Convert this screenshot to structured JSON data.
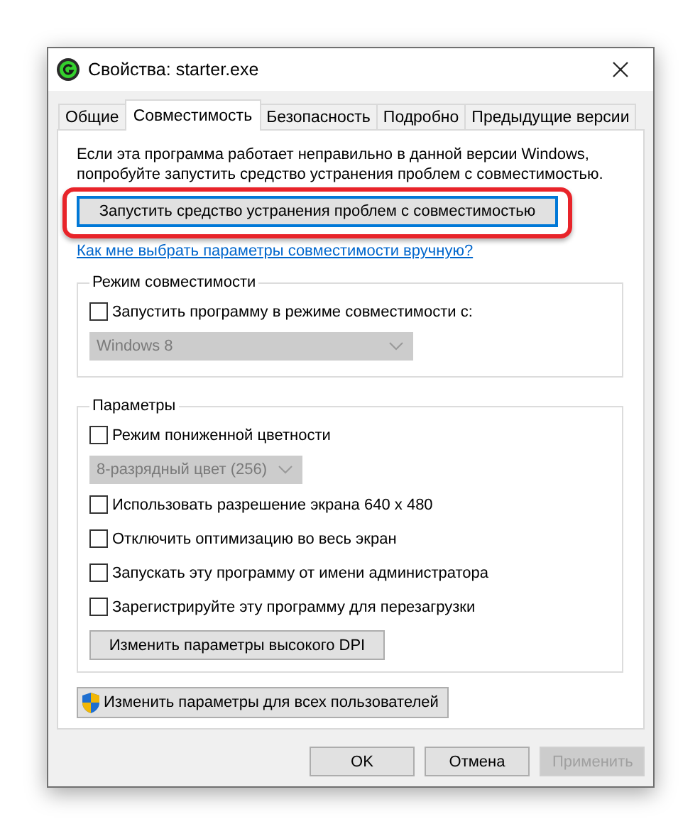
{
  "window": {
    "title": "Свойства: starter.exe"
  },
  "tabs": [
    {
      "label": "Общие",
      "selected": false
    },
    {
      "label": "Совместимость",
      "selected": true
    },
    {
      "label": "Безопасность",
      "selected": false
    },
    {
      "label": "Подробно",
      "selected": false
    },
    {
      "label": "Предыдущие версии",
      "selected": false
    }
  ],
  "intro": "Если эта программа работает неправильно в данной версии Windows, попробуйте запустить средство устранения проблем с совместимостью.",
  "troubleshoot_button": {
    "label": "Запустить средство устранения проблем с совместимостью",
    "highlighted": true
  },
  "manual_link": "Как мне выбрать параметры совместимости вручную?",
  "groups": [
    {
      "title": "Режим совместимости",
      "items": [
        {
          "kind": "checkbox",
          "label": "Запустить программу в режиме совместимости с:",
          "checked": false
        },
        {
          "kind": "combo",
          "value": "Windows 8",
          "disabled": true,
          "wide": true
        }
      ]
    },
    {
      "title": "Параметры",
      "items": [
        {
          "kind": "checkbox",
          "label": "Режим пониженной цветности",
          "checked": false
        },
        {
          "kind": "combo",
          "value": "8-разрядный цвет (256)",
          "disabled": true,
          "wide": false
        },
        {
          "kind": "checkbox",
          "label": "Использовать разрешение экрана 640 x 480",
          "checked": false
        },
        {
          "kind": "checkbox",
          "label": "Отключить оптимизацию во весь экран",
          "checked": false
        },
        {
          "kind": "checkbox",
          "label": "Запускать эту программу от имени администратора",
          "checked": false
        },
        {
          "kind": "checkbox",
          "label": "Зарегистрируйте эту программу для перезагрузки",
          "checked": false
        },
        {
          "kind": "button",
          "label": "Изменить параметры высокого DPI"
        }
      ]
    }
  ],
  "all_users_button": {
    "label": "Изменить параметры для всех пользователей"
  },
  "buttons": [
    {
      "label": "OK",
      "disabled": false
    },
    {
      "label": "Отмена",
      "disabled": false
    },
    {
      "label": "Применить",
      "disabled": true
    }
  ]
}
